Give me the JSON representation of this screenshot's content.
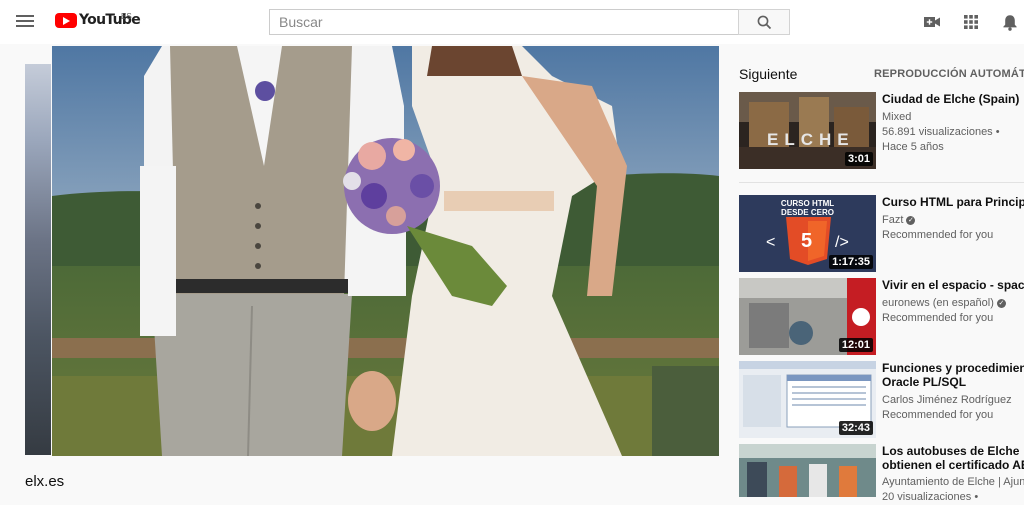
{
  "header": {
    "logo_text": "YouTube",
    "country_code": "ES",
    "search_placeholder": "Buscar"
  },
  "main": {
    "channel_name": "elx.es"
  },
  "sidebar": {
    "title": "Siguiente",
    "autoplay_label": "REPRODUCCIÓN AUTOMÁTICA",
    "videos": [
      {
        "title_lines": [
          "Ciudad de Elche (Spain)"
        ],
        "channel": "Mixed",
        "verified": false,
        "meta": [
          "56.891 visualizaciones •",
          "Hace 5 años"
        ],
        "duration": "3:01",
        "thumb_text": "ELCHE"
      },
      {
        "title_lines": [
          "Curso HTML para Principiantes"
        ],
        "channel": "Fazt",
        "verified": true,
        "meta": [
          "Recommended for you"
        ],
        "duration": "1:17:35",
        "thumb_text_1": "CURSO HTML",
        "thumb_text_2": "DESDE CERO"
      },
      {
        "title_lines": [
          "Vivir en el espacio - space"
        ],
        "channel": "euronews (en español)",
        "verified": true,
        "meta": [
          "Recommended for you"
        ],
        "duration": "12:01"
      },
      {
        "title_lines": [
          "Funciones y procedimientos",
          "Oracle PL/SQL"
        ],
        "channel": "Carlos Jiménez Rodríguez",
        "verified": false,
        "meta": [
          "Recommended for you"
        ],
        "duration": "32:43"
      },
      {
        "title_lines": [
          "Los autobuses de Elche",
          "obtienen el certificado AENOR"
        ],
        "channel": "Ayuntamiento de Elche | Ajuntament",
        "verified": false,
        "meta": [
          "20 visualizaciones •"
        ],
        "duration": ""
      }
    ]
  },
  "colors": {
    "brand_red": "#ff0000",
    "text_primary": "#0f0f0f",
    "text_secondary": "#606060",
    "background": "#f9f9f9"
  },
  "icons": {
    "menu": "hamburger-icon",
    "search": "search-icon",
    "create": "video-camera-icon",
    "apps": "grid-apps-icon",
    "notifications": "bell-icon"
  }
}
